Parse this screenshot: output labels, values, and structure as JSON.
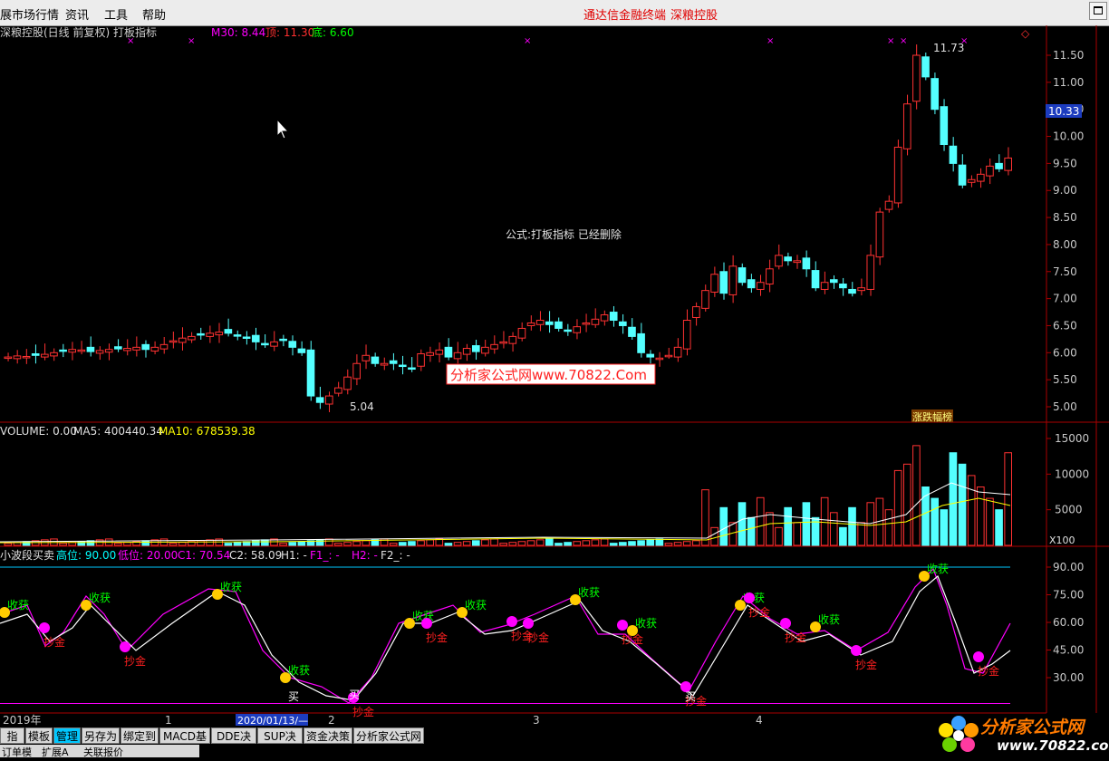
{
  "menu": {
    "items": [
      "展市场行情",
      "资讯",
      "工具",
      "帮助"
    ],
    "right_items": [
      "通达信金融终端",
      "深粮控股"
    ]
  },
  "main_chart": {
    "title": "深粮控股(日线 前复权) 打板指标",
    "ma_labels": [
      {
        "text": "M30: 8.44",
        "color": "#ff00ff"
      },
      {
        "text": "顶: 11.30",
        "color": "#ff3030"
      },
      {
        "text": "底: 6.60",
        "color": "#00ff00"
      }
    ],
    "notice": "公式:打板指标 已经删除",
    "high_label": "11.73",
    "low_label": "5.04",
    "current_price": "10.33",
    "y_ticks": [
      "11.50",
      "11.00",
      "10.50",
      "10.00",
      "9.50",
      "9.00",
      "8.50",
      "8.00",
      "7.50",
      "7.00",
      "6.50",
      "6.00",
      "5.50",
      "5.00"
    ],
    "watermark": "分析家公式网www.70822.Com",
    "badge": "涨跌幅榜",
    "diamond": "◇"
  },
  "volume_chart": {
    "labels": [
      {
        "text": "VOLUME: 0.00",
        "color": "#e0e0e0"
      },
      {
        "text": "MA5: 400440.34",
        "color": "#e0e0e0"
      },
      {
        "text": "MA10: 678539.38",
        "color": "#ffff00"
      }
    ],
    "y_ticks": [
      "15000",
      "10000",
      "5000"
    ],
    "unit": "X100"
  },
  "indicator_chart": {
    "labels": [
      {
        "text": "小波段买卖",
        "color": "#e0e0e0"
      },
      {
        "text": "高位: 90.00",
        "color": "#00ffff"
      },
      {
        "text": "低位: 20.00",
        "color": "#ff00ff"
      },
      {
        "text": "C1: 70.54",
        "color": "#ff00ff"
      },
      {
        "text": "C2: 58.09",
        "color": "#e0e0e0"
      },
      {
        "text": "H1: -",
        "color": "#e0e0e0"
      },
      {
        "text": "F1_: -",
        "color": "#ff00ff"
      },
      {
        "text": "H2: -",
        "color": "#ff00ff"
      },
      {
        "text": "F2_: -",
        "color": "#e0e0e0"
      }
    ],
    "y_ticks": [
      "90.00",
      "75.00",
      "60.00",
      "45.00",
      "30.00"
    ],
    "sell_text": "收获",
    "gold_text": "抄金",
    "buy_text": "买",
    "high_level": 90,
    "low_level": 20
  },
  "time_axis": {
    "labels": [
      "2019年",
      "1",
      "2020/01/13/—",
      "2",
      "3",
      "4"
    ]
  },
  "bottom_tabs": {
    "items": [
      "指标",
      "模板",
      "管理",
      "另存为",
      "绑定到",
      "MACD基本",
      "DDE决策",
      "SUP决策",
      "资金决策",
      "分析家公式网"
    ],
    "active_index": 2,
    "sub_items": [
      "订单模",
      "扩展A",
      "关联报价"
    ]
  },
  "logo": {
    "text": "分析家公式网",
    "url": "www.70822.com"
  },
  "colors": {
    "up": "#ff3232",
    "down": "#54ffff",
    "grid": "#7a0000",
    "axis_text": "#c8c8c8"
  }
}
